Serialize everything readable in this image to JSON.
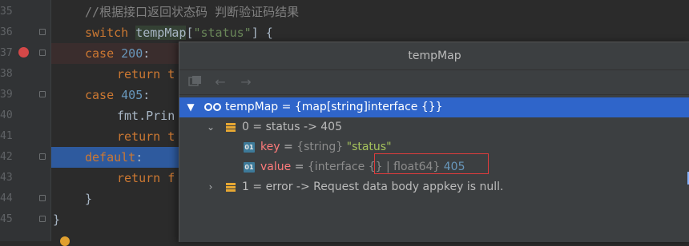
{
  "editor": {
    "line_numbers": [
      "35",
      "36",
      "37",
      "38",
      "39",
      "40",
      "41",
      "42",
      "43",
      "44",
      "45"
    ],
    "lines": {
      "comment": "//根据接口返回状态码 判断验证码结果",
      "switch_kw": "switch",
      "switch_ident": "tempMap",
      "switch_key": "\"status\"",
      "switch_tail": "] {",
      "case1_kw": "case",
      "case1_val": "200",
      "case1_colon": ":",
      "return1": "return t",
      "case2_kw": "case",
      "case2_val": "405",
      "case2_colon": ":",
      "print": "fmt.Prin",
      "return2": "return t",
      "default_kw": "default",
      "default_colon": ":",
      "return3": "return f",
      "brace_inner": "}",
      "brace_outer": "}"
    }
  },
  "popup": {
    "title": "tempMap",
    "toolbar": [
      "copy-icon",
      "back-arrow-icon",
      "forward-arrow-icon"
    ],
    "root": {
      "name": "tempMap",
      "type": "{map[string]interface {}}"
    },
    "entry0": {
      "index": "0",
      "label": "status -> 405",
      "key_name": "key",
      "key_type": "{string}",
      "key_value": "\"status\"",
      "value_name": "value",
      "value_type": "{interface {} | float64}",
      "value_value": "405"
    },
    "entry1": {
      "index": "1",
      "label": "error -> Request data body appkey is null."
    },
    "colors": {
      "selection": "#2f65ca",
      "highlight_box": "#e03c3c",
      "breakpoint": "#d44848"
    }
  }
}
